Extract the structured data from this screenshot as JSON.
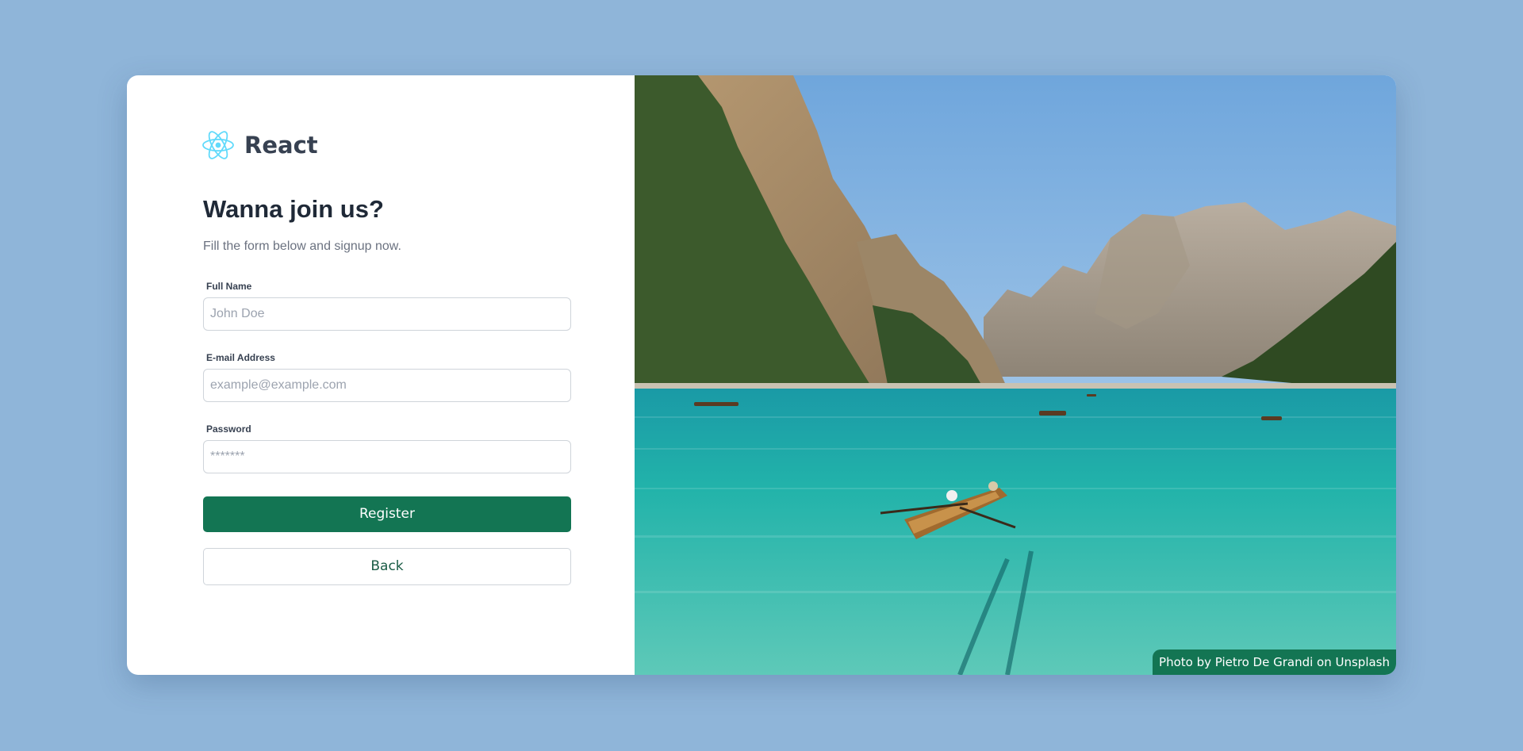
{
  "brand": {
    "name": "React",
    "logo_icon": "react-atom-icon",
    "logo_color": "#61dafb"
  },
  "form": {
    "title": "Wanna join us?",
    "subtitle": "Fill the form below and signup now.",
    "full_name": {
      "label": "Full Name",
      "placeholder": "John Doe",
      "value": ""
    },
    "email": {
      "label": "E-mail Address",
      "placeholder": "example@example.com",
      "value": ""
    },
    "password": {
      "label": "Password",
      "placeholder": "*******",
      "value": ""
    },
    "register_label": "Register",
    "back_label": "Back"
  },
  "photo": {
    "credit": "Photo by Pietro De Grandi on Unsplash"
  },
  "colors": {
    "background": "#8fb5d9",
    "accent": "#137553",
    "text_dark": "#1f2937",
    "text_muted": "#6b7280"
  }
}
